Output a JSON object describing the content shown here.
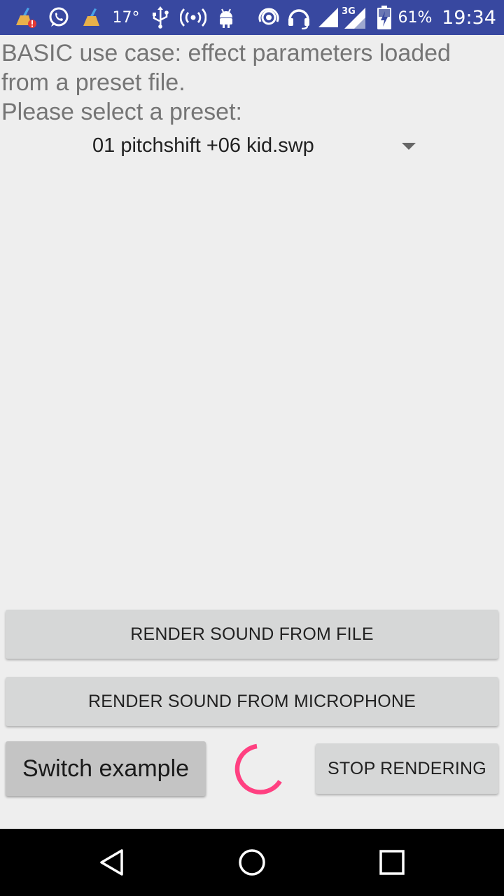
{
  "status_bar": {
    "temperature": "17°",
    "network_type": "3G",
    "battery_percent": "61%",
    "clock": "19:34",
    "icons": [
      "cleaner-alert-icon",
      "whatsapp-icon",
      "cleaner-icon",
      "usb-icon",
      "hotspot-icon",
      "android-icon",
      "cast-icon",
      "headset-icon",
      "signal-icon",
      "signal-3g-icon",
      "battery-charging-icon"
    ],
    "background_color": "#3848a0"
  },
  "content": {
    "intro_text": "BASIC use case: effect parameters loaded from a preset file.",
    "prompt_text": "Please select a preset:",
    "preset_selected": "01 pitchshift +06 kid.swp"
  },
  "buttons": {
    "render_file": "RENDER SOUND FROM FILE",
    "render_microphone": "RENDER SOUND FROM MICROPHONE",
    "switch_example": "Switch example",
    "stop_rendering": "STOP RENDERING"
  },
  "colors": {
    "accent": "#ff4081",
    "button_bg": "#d6d7d7",
    "secondary_text": "#757575"
  },
  "nav_bar": {
    "icons": [
      "back-icon",
      "home-icon",
      "recents-icon"
    ]
  }
}
